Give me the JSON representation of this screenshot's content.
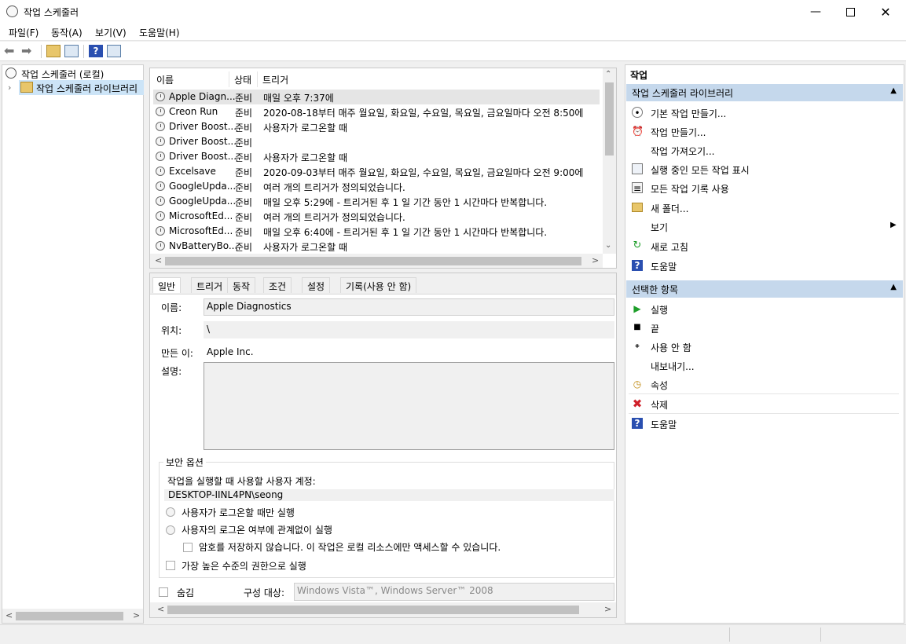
{
  "window": {
    "title": "작업 스케줄러"
  },
  "menu": [
    "파일(F)",
    "동작(A)",
    "보기(V)",
    "도움말(H)"
  ],
  "tree": {
    "root": "작업 스케줄러 (로컬)",
    "child": "작업 스케줄러 라이브러리"
  },
  "tasklist": {
    "headers": [
      "이름",
      "상태",
      "트리거"
    ],
    "rows": [
      {
        "name": "Apple Diagn...",
        "status": "준비",
        "trigger": "매일 오후 7:37에"
      },
      {
        "name": "Creon Run",
        "status": "준비",
        "trigger": "2020-08-18부터 매주 월요일, 화요일, 수요일, 목요일, 금요일마다 오전 8:50에"
      },
      {
        "name": "Driver Boost...",
        "status": "준비",
        "trigger": "사용자가 로그온할 때"
      },
      {
        "name": "Driver Boost...",
        "status": "준비",
        "trigger": ""
      },
      {
        "name": "Driver Boost...",
        "status": "준비",
        "trigger": "사용자가 로그온할 때"
      },
      {
        "name": "Excelsave",
        "status": "준비",
        "trigger": "2020-09-03부터 매주 월요일, 화요일, 수요일, 목요일, 금요일마다 오전 9:00에"
      },
      {
        "name": "GoogleUpda...",
        "status": "준비",
        "trigger": "여러 개의 트리거가 정의되었습니다."
      },
      {
        "name": "GoogleUpda...",
        "status": "준비",
        "trigger": "매일 오후 5:29에 - 트리거된 후 1 일 기간 동안 1 시간마다 반복합니다."
      },
      {
        "name": "MicrosoftEd...",
        "status": "준비",
        "trigger": "여러 개의 트리거가 정의되었습니다."
      },
      {
        "name": "MicrosoftEd...",
        "status": "준비",
        "trigger": "매일 오후 6:40에 - 트리거된 후 1 일 기간 동안 1 시간마다 반복합니다."
      },
      {
        "name": "NvBatteryBo...",
        "status": "준비",
        "trigger": "사용자가 로그온할 때"
      }
    ]
  },
  "details": {
    "tabs": [
      "일반",
      "트리거",
      "동작",
      "조건",
      "설정",
      "기록(사용 안 함)"
    ],
    "name_label": "이름:",
    "name_value": "Apple Diagnostics",
    "location_label": "위치:",
    "location_value": "\\",
    "author_label": "만든 이:",
    "author_value": "Apple Inc.",
    "desc_label": "설명:",
    "security_title": "보안 옵션",
    "account_label": "작업을 실행할 때 사용할 사용자 계정:",
    "account_value": "DESKTOP-IINL4PN\\seong",
    "radio1": "사용자가 로그온할 때만 실행",
    "radio2": "사용자의 로그온 여부에 관계없이 실행",
    "chk_nopass": "암호를 저장하지 않습니다. 이 작업은 로컬 리소스에만 액세스할 수 있습니다.",
    "chk_highest": "가장 높은 수준의 권한으로 실행",
    "hidden_label": "숨김",
    "config_label": "구성 대상:",
    "config_value": "Windows Vista™, Windows Server™ 2008"
  },
  "actions": {
    "title": "작업",
    "section1": "작업 스케줄러 라이브러리",
    "items1": [
      {
        "label": "기본 작업 만들기...",
        "icon": "wizard-icon"
      },
      {
        "label": "작업 만들기...",
        "icon": "create-task-icon"
      },
      {
        "label": "작업 가져오기...",
        "icon": ""
      },
      {
        "label": "실행 중인 모든 작업 표시",
        "icon": "running-tasks-icon"
      },
      {
        "label": "모든 작업 기록 사용",
        "icon": "history-icon"
      },
      {
        "label": "새 폴더...",
        "icon": "folder-icon"
      },
      {
        "label": "보기",
        "icon": ""
      },
      {
        "label": "새로 고침",
        "icon": "refresh-icon"
      },
      {
        "label": "도움말",
        "icon": "help-icon"
      }
    ],
    "section2": "선택한 항목",
    "items2": [
      {
        "label": "실행",
        "icon": "run-icon"
      },
      {
        "label": "끝",
        "icon": "end-icon"
      },
      {
        "label": "사용 안 함",
        "icon": "disable-icon"
      },
      {
        "label": "내보내기...",
        "icon": ""
      },
      {
        "label": "속성",
        "icon": "properties-icon"
      },
      {
        "label": "삭제",
        "icon": "delete-icon"
      },
      {
        "label": "도움말",
        "icon": "help-icon"
      }
    ]
  },
  "colors": {
    "section_header": "#c5d8ec",
    "selected_row": "#e5e5e5",
    "run_green": "#1e9e2a",
    "delete_red": "#d0202a",
    "help_blue": "#2a4fb0"
  }
}
